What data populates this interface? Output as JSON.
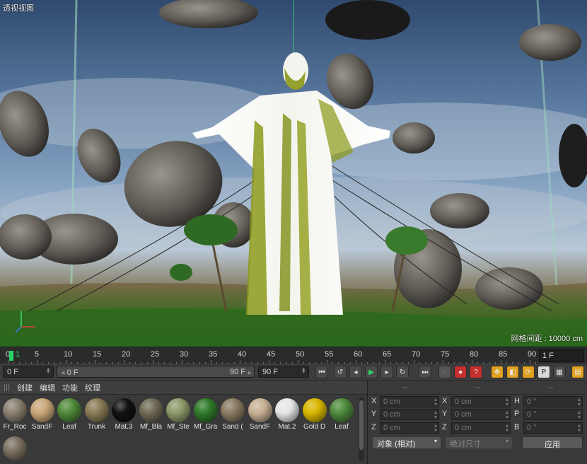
{
  "viewport": {
    "label": "透视视图",
    "grid_spacing": "网格间距 : 10000 cm"
  },
  "timeline": {
    "ticks": [
      "0",
      "5",
      "10",
      "15",
      "20",
      "25",
      "30",
      "35",
      "40",
      "45",
      "50",
      "55",
      "60",
      "65",
      "70",
      "75",
      "80",
      "85",
      "90"
    ],
    "current_frame_marker": "1",
    "frame_field": "1 F"
  },
  "transport": {
    "start_field": "0 F",
    "range_start": "0 F",
    "range_end": "90 F",
    "end_field": "90 F"
  },
  "material_manager": {
    "menu": [
      "创建",
      "编辑",
      "功能",
      "纹理"
    ],
    "materials": [
      {
        "label": "Fr_Roc",
        "color": "#8a8070"
      },
      {
        "label": "SandF",
        "color": "#c9a679"
      },
      {
        "label": "Leaf",
        "color": "#4f8a3a"
      },
      {
        "label": "Trunk",
        "color": "#8a7a55"
      },
      {
        "label": "Mat.3",
        "color": "#111111"
      },
      {
        "label": "Mf_Bla",
        "color": "#6f6a55"
      },
      {
        "label": "Mf_Ste",
        "color": "#8d9a6a"
      },
      {
        "label": "Mf_Gra",
        "color": "#2f7a2a"
      },
      {
        "label": "Sand (",
        "color": "#8a7a60"
      },
      {
        "label": "SandF",
        "color": "#c8b094"
      },
      {
        "label": "Mat.2",
        "color": "#e6e6e6"
      },
      {
        "label": "Gold D",
        "color": "#d8b600"
      },
      {
        "label": "Leaf",
        "color": "#4e8a3c"
      },
      {
        "label": "",
        "color": "#7a7060"
      }
    ]
  },
  "coordinates": {
    "headers": [
      "--",
      "--",
      "--"
    ],
    "rows": [
      {
        "a1": "X",
        "v1": "0 cm",
        "a2": "X",
        "v2": "0 cm",
        "a3": "H",
        "v3": "0 °"
      },
      {
        "a1": "Y",
        "v1": "0 cm",
        "a2": "Y",
        "v2": "0 cm",
        "a3": "P",
        "v3": "0 °"
      },
      {
        "a1": "Z",
        "v1": "0 cm",
        "a2": "Z",
        "v2": "0 cm",
        "a3": "B",
        "v3": "0 °"
      }
    ],
    "mode_dropdown": "对象 (相对)",
    "size_dropdown": "绝对尺寸",
    "apply_button": "应用"
  }
}
